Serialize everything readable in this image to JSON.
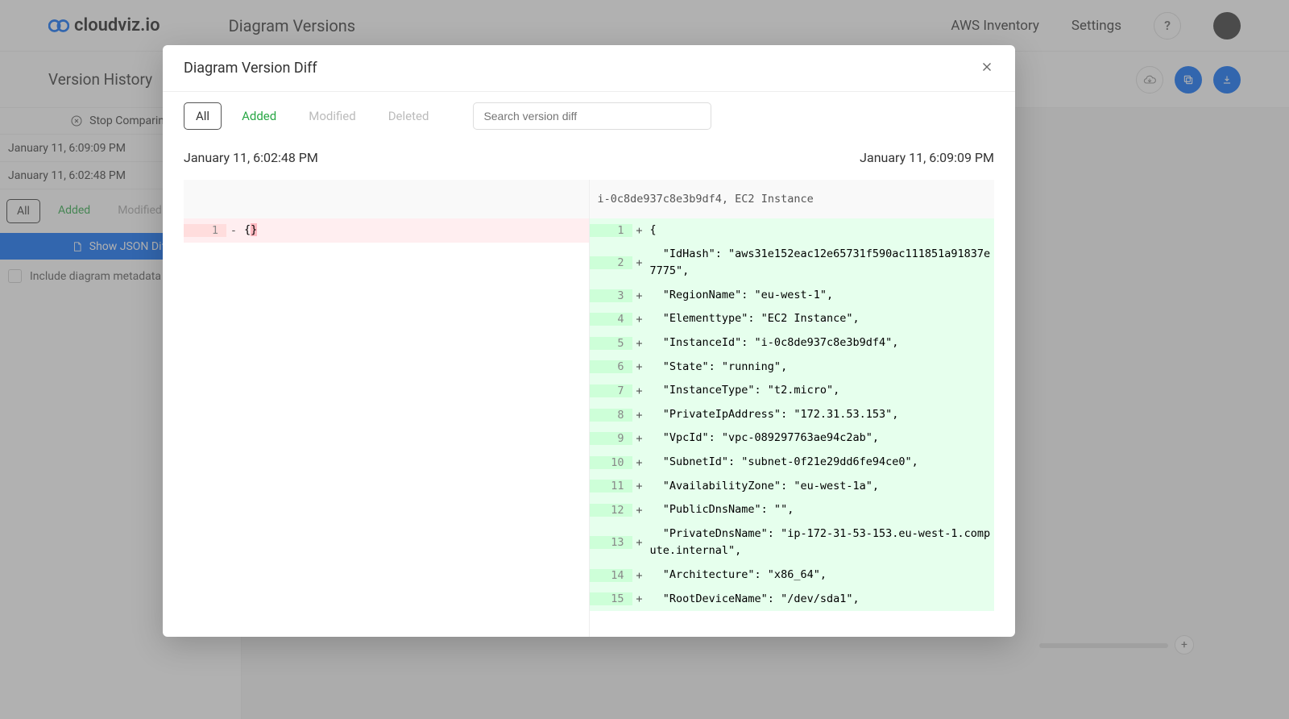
{
  "header": {
    "logo_text": "cloudviz.io",
    "page_title": "Diagram Versions",
    "nav": {
      "aws_inventory": "AWS Inventory",
      "settings": "Settings"
    }
  },
  "toolbar": {
    "title": "Version History"
  },
  "sidebar": {
    "stop_comparing": "Stop Comparing",
    "versions": [
      {
        "ts": "January 11, 6:09:09 PM"
      },
      {
        "ts": "January 11, 6:02:48 PM"
      }
    ],
    "filters": {
      "all": "All",
      "added": "Added",
      "modified": "Modified"
    },
    "show_json": "Show JSON Diff",
    "checkbox_label": "Include diagram metadata"
  },
  "modal": {
    "title": "Diagram Version Diff",
    "tabs": {
      "all": "All",
      "added": "Added",
      "modified": "Modified",
      "deleted": "Deleted"
    },
    "search_placeholder": "Search version diff",
    "left_ts": "January 11, 6:02:48 PM",
    "right_ts": "January 11, 6:09:09 PM",
    "file_header": "i-0c8de937c8e3b9df4, EC2 Instance",
    "left_lines": [
      {
        "num": "1",
        "marker": "-",
        "content": "{",
        "removed_tail": "}"
      }
    ],
    "right_lines": [
      {
        "num": "1",
        "marker": "+",
        "content": "{"
      },
      {
        "num": "2",
        "marker": "+",
        "content": "  \"IdHash\": \"aws31e152eac12e65731f590ac111851a91837e7775\","
      },
      {
        "num": "3",
        "marker": "+",
        "content": "  \"RegionName\": \"eu-west-1\","
      },
      {
        "num": "4",
        "marker": "+",
        "content": "  \"Elementtype\": \"EC2 Instance\","
      },
      {
        "num": "5",
        "marker": "+",
        "content": "  \"InstanceId\": \"i-0c8de937c8e3b9df4\","
      },
      {
        "num": "6",
        "marker": "+",
        "content": "  \"State\": \"running\","
      },
      {
        "num": "7",
        "marker": "+",
        "content": "  \"InstanceType\": \"t2.micro\","
      },
      {
        "num": "8",
        "marker": "+",
        "content": "  \"PrivateIpAddress\": \"172.31.53.153\","
      },
      {
        "num": "9",
        "marker": "+",
        "content": "  \"VpcId\": \"vpc-089297763ae94c2ab\","
      },
      {
        "num": "10",
        "marker": "+",
        "content": "  \"SubnetId\": \"subnet-0f21e29dd6fe94ce0\","
      },
      {
        "num": "11",
        "marker": "+",
        "content": "  \"AvailabilityZone\": \"eu-west-1a\","
      },
      {
        "num": "12",
        "marker": "+",
        "content": "  \"PublicDnsName\": \"\","
      },
      {
        "num": "13",
        "marker": "+",
        "content": "  \"PrivateDnsName\": \"ip-172-31-53-153.eu-west-1.compute.internal\","
      },
      {
        "num": "14",
        "marker": "+",
        "content": "  \"Architecture\": \"x86_64\","
      },
      {
        "num": "15",
        "marker": "+",
        "content": "  \"RootDeviceName\": \"/dev/sda1\","
      }
    ]
  }
}
